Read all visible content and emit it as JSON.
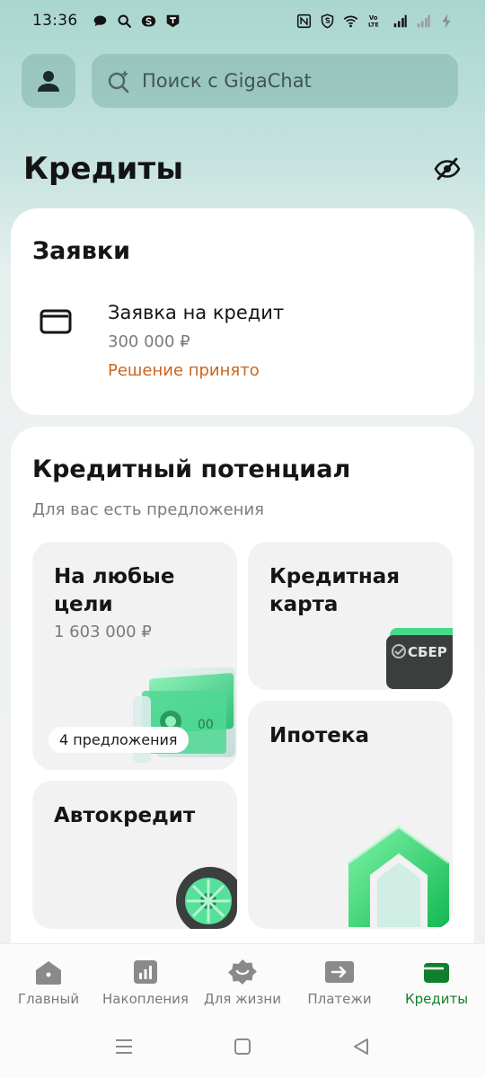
{
  "status_bar": {
    "time": "13:36",
    "left_icons": [
      "chat-bubble-icon",
      "search-icon",
      "s-app-icon",
      "t-app-icon"
    ],
    "right_icons": [
      "nfc-icon",
      "shield-s-icon",
      "wifi-icon",
      "volte-icon",
      "signal-icon",
      "signal-empty-icon",
      "charging-icon"
    ],
    "volte_text": "Vo LTE"
  },
  "header": {
    "search_placeholder": "Поиск с GigaChat"
  },
  "page": {
    "title": "Кредиты"
  },
  "applications": {
    "title": "Заявки",
    "item": {
      "name": "Заявка на кредит",
      "amount": "300 000 ₽",
      "status": "Решение принято"
    }
  },
  "potential": {
    "title": "Кредитный потенциал",
    "subtitle": "Для вас есть предложения",
    "tiles": {
      "any_goals": {
        "title_line1": "На любые",
        "title_line2": "цели",
        "amount": "1 603 000 ₽",
        "badge": "4 предложения"
      },
      "credit_card": {
        "title_line1": "Кредитная",
        "title_line2": "карта",
        "card_brand": "СБЕР"
      },
      "mortgage": {
        "title": "Ипотека"
      },
      "car_loan": {
        "title": "Автокредит"
      }
    }
  },
  "bottom_nav": [
    {
      "label": "Главный",
      "icon": "home-icon",
      "active": false
    },
    {
      "label": "Накопления",
      "icon": "savings-chart-icon",
      "active": false
    },
    {
      "label": "Для жизни",
      "icon": "lifestyle-smile-icon",
      "active": false
    },
    {
      "label": "Платежи",
      "icon": "payments-arrow-icon",
      "active": false
    },
    {
      "label": "Кредиты",
      "icon": "wallet-icon",
      "active": true
    }
  ],
  "colors": {
    "accent_green": "#107f2d",
    "status_orange": "#c8661f",
    "header_gradient_top": "#a9d6cf"
  }
}
